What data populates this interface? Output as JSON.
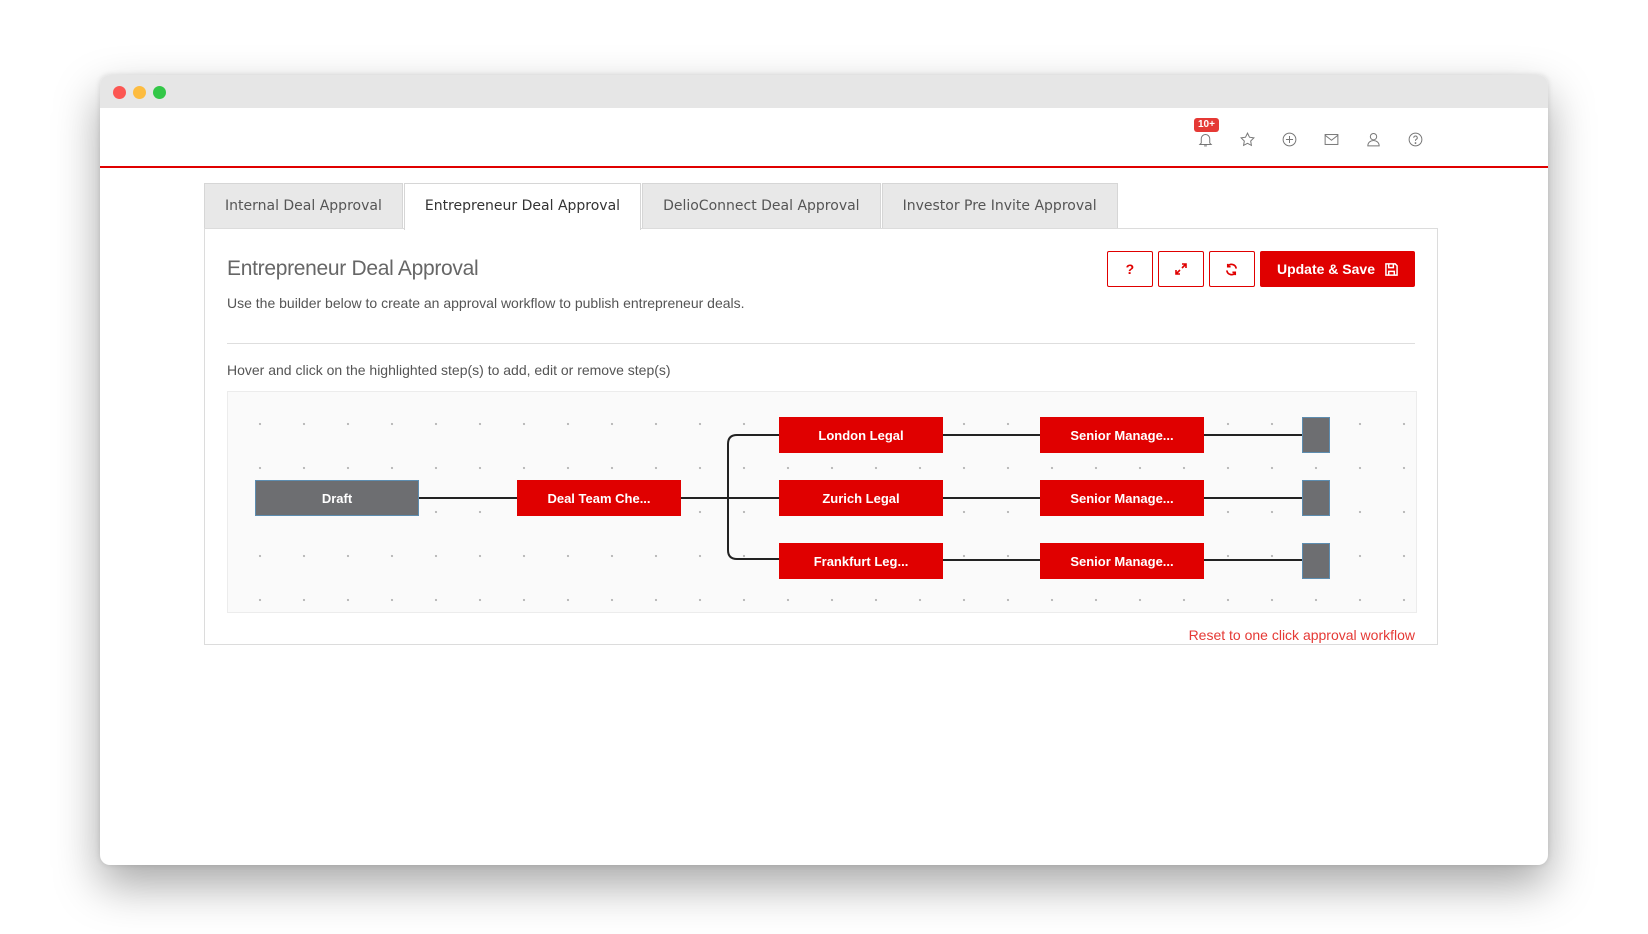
{
  "header": {
    "notification_badge": "10+",
    "icons": [
      "bell-icon",
      "star-icon",
      "plus-circle-icon",
      "mail-icon",
      "user-icon",
      "help-circle-icon"
    ]
  },
  "tabs": [
    {
      "label": "Internal Deal Approval",
      "active": false
    },
    {
      "label": "Entrepreneur Deal Approval",
      "active": true
    },
    {
      "label": "DelioConnect Deal Approval",
      "active": false
    },
    {
      "label": "Investor Pre Invite Approval",
      "active": false
    }
  ],
  "panel": {
    "title": "Entrepreneur Deal Approval",
    "description": "Use the builder below to create an approval workflow to publish entrepreneur deals.",
    "help_label": "?",
    "save_label": "Update & Save",
    "hint": "Hover and click on the highlighted step(s) to add, edit or remove step(s)",
    "reset_link": "Reset to one click approval workflow"
  },
  "workflow": {
    "start": "Draft",
    "check": "Deal Team Che...",
    "branches": [
      {
        "legal": "London Legal",
        "management": "Senior Manage..."
      },
      {
        "legal": "Zurich Legal",
        "management": "Senior Manage..."
      },
      {
        "legal": "Frankfurt Leg...",
        "management": "Senior Manage..."
      }
    ]
  },
  "colors": {
    "accent": "#e00000",
    "node_grey": "#6d6e71",
    "link_red": "#e53935"
  }
}
